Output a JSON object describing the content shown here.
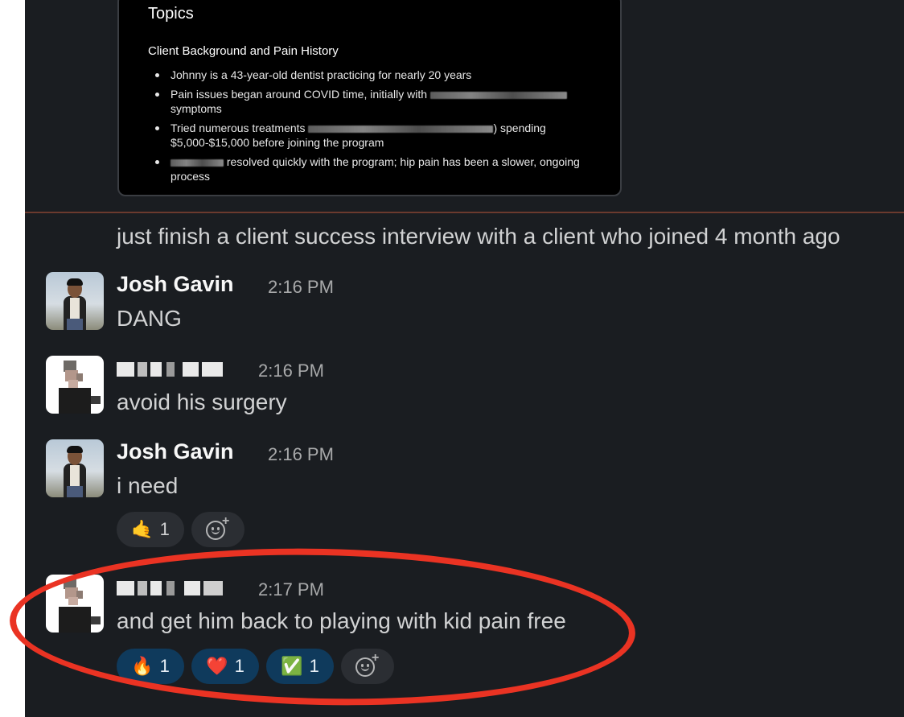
{
  "document_preview": {
    "title": "Topics",
    "subtitle": "Client Background and Pain History",
    "items": [
      {
        "before": "Johnny is a 43-year-old dentist practicing for nearly 20 years",
        "after": ""
      },
      {
        "before": "Pain issues began around COVID time, initially with",
        "after": "symptoms"
      },
      {
        "before": "Tried numerous treatments",
        "after": ") spending $5,000-$15,000 before joining the program"
      },
      {
        "before": "",
        "after": "resolved quickly with the program; hip pain has been a slower, ongoing process"
      }
    ]
  },
  "standalone_message": "just finish a client success interview with a client who joined 4 month ago",
  "messages": [
    {
      "author": "Josh Gavin",
      "time": "2:16 PM",
      "text": "DANG"
    },
    {
      "author": "",
      "time": "2:16 PM",
      "text": "avoid his surgery"
    },
    {
      "author": "Josh Gavin",
      "time": "2:16 PM",
      "text": "i need",
      "reactions": [
        {
          "emoji": "🤙",
          "count": "1"
        }
      ]
    },
    {
      "author": "",
      "time": "2:17 PM",
      "text": "and get him back to playing with kid pain free",
      "reactions": [
        {
          "emoji": "🔥",
          "count": "1"
        },
        {
          "emoji": "❤️",
          "count": "1"
        },
        {
          "emoji": "✅",
          "count": "1"
        }
      ]
    }
  ],
  "icons": {
    "add_reaction": "add-reaction-icon"
  },
  "colors": {
    "background": "#1a1d21",
    "reaction_active": "#0f3a5c",
    "reaction_neutral": "#2b2e33",
    "annotation": "#ea3323",
    "divider": "#6b3a2e"
  }
}
